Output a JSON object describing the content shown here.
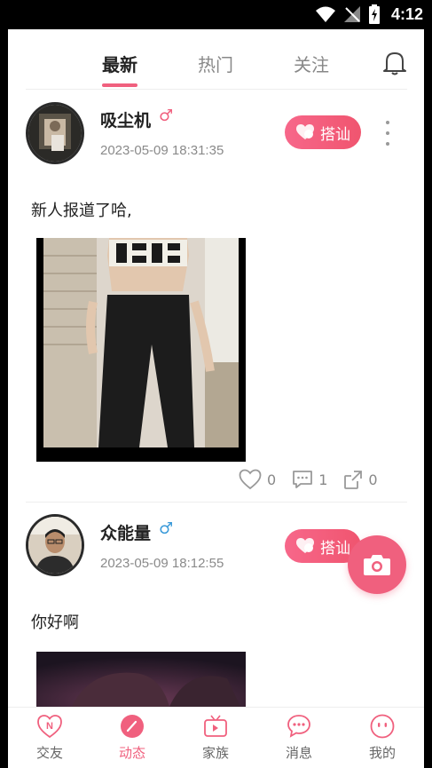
{
  "status_bar": {
    "time": "4:12"
  },
  "tabs": [
    {
      "label": "最新",
      "active": true
    },
    {
      "label": "热门",
      "active": false
    },
    {
      "label": "关注",
      "active": false
    }
  ],
  "posts": [
    {
      "username": "吸尘机",
      "gender_symbol": "♂",
      "gender_color": "#f0607e",
      "timestamp": "2023-05-09 18:31:35",
      "greet_label": "搭讪",
      "content": "新人报道了哈,",
      "likes": "0",
      "comments": "1",
      "shares": "0"
    },
    {
      "username": "众能量",
      "gender_symbol": "♂",
      "gender_color": "#3a9ad9",
      "timestamp": "2023-05-09 18:12:55",
      "greet_label": "搭讪",
      "content": "你好啊"
    }
  ],
  "bottom_nav": [
    {
      "label": "交友",
      "icon": "heart-n-icon",
      "active": false
    },
    {
      "label": "动态",
      "icon": "feed-icon",
      "active": true
    },
    {
      "label": "家族",
      "icon": "tv-icon",
      "active": false
    },
    {
      "label": "消息",
      "icon": "message-icon",
      "active": false
    },
    {
      "label": "我的",
      "icon": "profile-face-icon",
      "active": false
    }
  ],
  "colors": {
    "accent": "#f0607e",
    "male_blue": "#3a9ad9"
  }
}
